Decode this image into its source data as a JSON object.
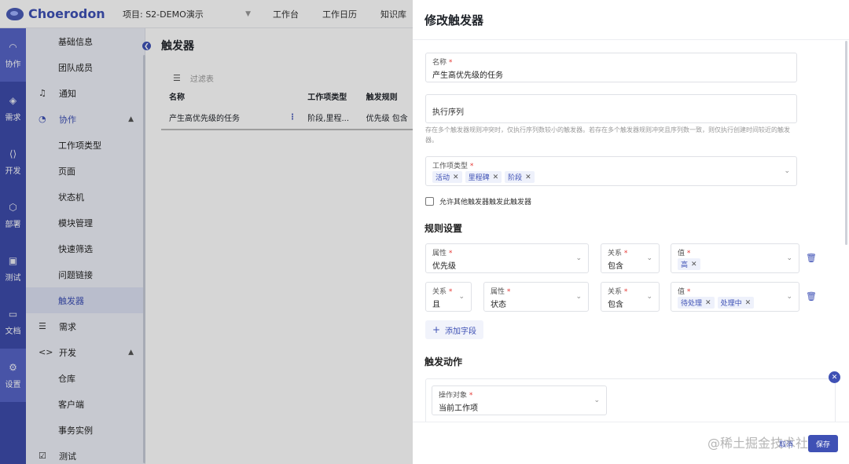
{
  "app": {
    "logo_text": "Choerodon",
    "project": "项目: S2-DEMO演示"
  },
  "topnav": [
    "工作台",
    "工作日历",
    "知识库"
  ],
  "rail": [
    {
      "label": "协作",
      "icon": "collab-icon"
    },
    {
      "label": "需求",
      "icon": "requirement-icon"
    },
    {
      "label": "开发",
      "icon": "develop-icon"
    },
    {
      "label": "部署",
      "icon": "deploy-icon"
    },
    {
      "label": "测试",
      "icon": "test-icon"
    },
    {
      "label": "文档",
      "icon": "doc-icon"
    },
    {
      "label": "设置",
      "icon": "settings-icon"
    }
  ],
  "sidebar": {
    "items": [
      {
        "label": "基础信息"
      },
      {
        "label": "团队成员"
      },
      {
        "label": "通知"
      },
      {
        "label": "协作"
      },
      {
        "label": "工作项类型"
      },
      {
        "label": "页面"
      },
      {
        "label": "状态机"
      },
      {
        "label": "模块管理"
      },
      {
        "label": "快速筛选"
      },
      {
        "label": "问题链接"
      },
      {
        "label": "触发器"
      },
      {
        "label": "需求"
      },
      {
        "label": "开发"
      },
      {
        "label": "仓库"
      },
      {
        "label": "客户端"
      },
      {
        "label": "事务实例"
      },
      {
        "label": "测试"
      }
    ]
  },
  "main": {
    "title": "触发器",
    "filter_placeholder": "过滤表",
    "columns": [
      "名称",
      "工作项类型",
      "触发规则"
    ],
    "rows": [
      [
        "产生高优先级的任务",
        "阶段,里程...",
        "优先级 包含"
      ]
    ]
  },
  "drawer": {
    "title": "修改触发器",
    "name_label": "名称",
    "name_value": "产生高优先级的任务",
    "order_placeholder": "执行序列",
    "hint": "存在多个触发器规则冲突时，仅执行序列数较小的触发器。若存在多个触发器规则冲突且序列数一致，则仅执行创建时间较近的触发器。",
    "type_label": "工作项类型",
    "type_tags": [
      "活动",
      "里程碑",
      "阶段"
    ],
    "allow_label": "允许其他触发器触发此触发器",
    "rules_title": "规则设置",
    "rule1": {
      "attr_label": "属性",
      "attr_value": "优先级",
      "rel_label": "关系",
      "rel_value": "包含",
      "val_label": "值",
      "val_tags": [
        "高"
      ]
    },
    "rule2": {
      "conj_label": "关系",
      "conj_value": "且",
      "attr_label": "属性",
      "attr_value": "状态",
      "rel_label": "关系",
      "rel_value": "包含",
      "val_label": "值",
      "val_tags": [
        "待处理",
        "处理中"
      ]
    },
    "add_field": "添加字段",
    "actions_title": "触发动作",
    "target_label": "操作对象",
    "target_value": "当前工作项",
    "cancel": "取消",
    "save": "保存",
    "watermark": "@稀土掘金技术社区"
  },
  "colors": {
    "primary": "#3f51b5",
    "rail": "#3d4cab"
  }
}
